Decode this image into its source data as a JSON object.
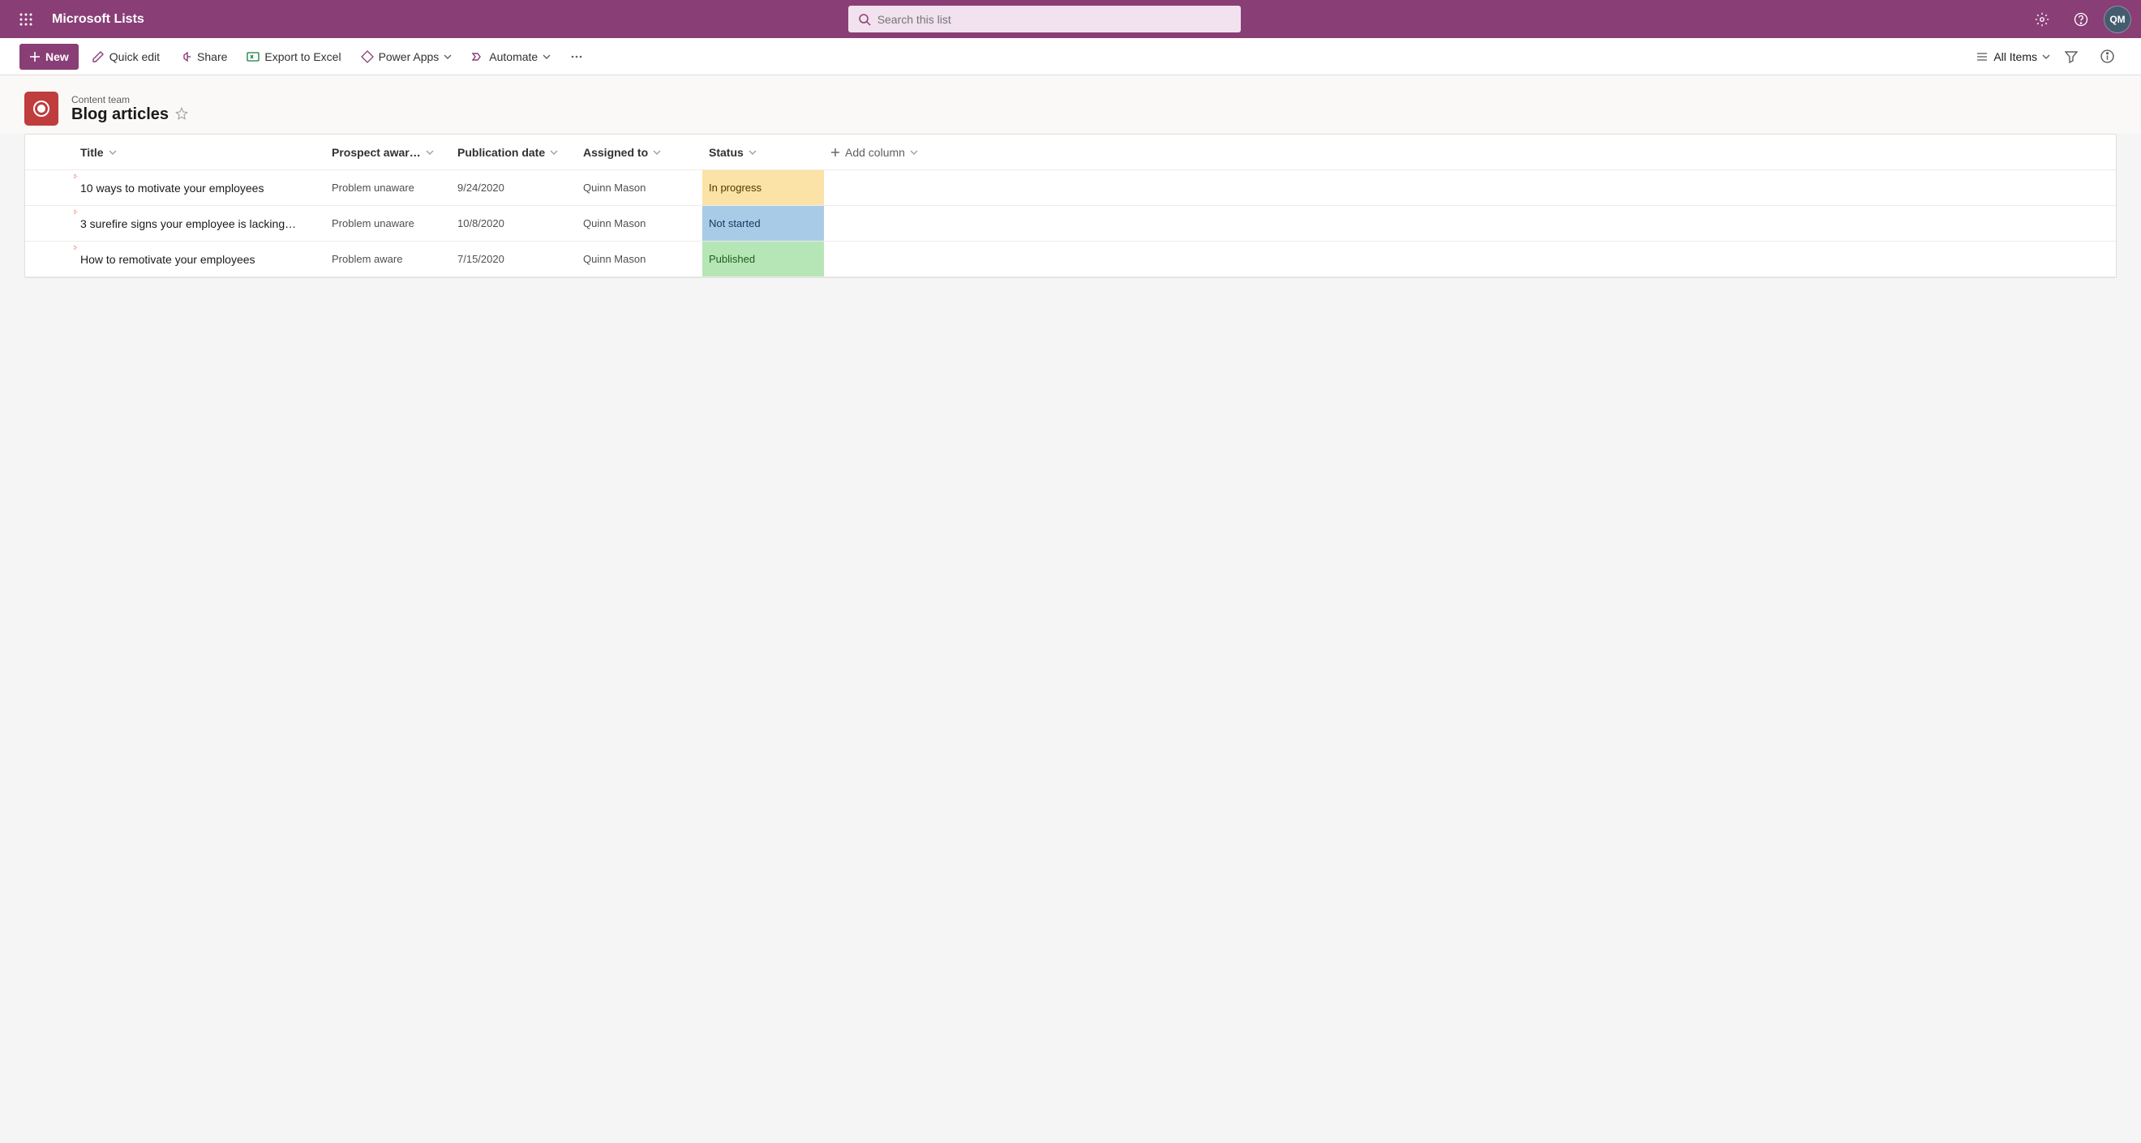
{
  "header": {
    "app_title": "Microsoft Lists",
    "search_placeholder": "Search this list",
    "avatar_initials": "QM"
  },
  "commands": {
    "new_label": "New",
    "quick_edit": "Quick edit",
    "share": "Share",
    "export": "Export to Excel",
    "power_apps": "Power Apps",
    "automate": "Automate",
    "view_label": "All Items"
  },
  "list_header": {
    "site": "Content team",
    "title": "Blog articles"
  },
  "columns": {
    "title": "Title",
    "prospect": "Prospect awar…",
    "pubdate": "Publication date",
    "assigned": "Assigned to",
    "status": "Status",
    "add_column": "Add column"
  },
  "rows": [
    {
      "title": "10 ways to motivate your employees",
      "prospect": "Problem unaware",
      "pubdate": "9/24/2020",
      "assigned": "Quinn Mason",
      "status_label": "In progress",
      "status_class": "status-inprogress"
    },
    {
      "title": "3 surefire signs your employee is lacking…",
      "prospect": "Problem unaware",
      "pubdate": "10/8/2020",
      "assigned": "Quinn Mason",
      "status_label": "Not started",
      "status_class": "status-notstarted"
    },
    {
      "title": "How to remotivate your employees",
      "prospect": "Problem aware",
      "pubdate": "7/15/2020",
      "assigned": "Quinn Mason",
      "status_label": "Published",
      "status_class": "status-published"
    }
  ]
}
